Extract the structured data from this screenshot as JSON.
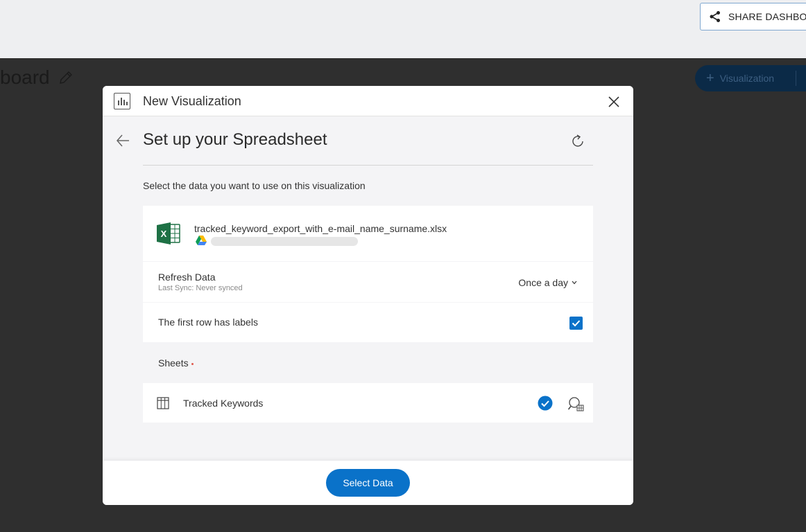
{
  "header": {
    "share_label": "SHARE DASHBOARD"
  },
  "dashboard": {
    "title_fragment": "board",
    "visualization_button_label": "Visualization"
  },
  "modal": {
    "title": "New Visualization",
    "section_title": "Set up your Spreadsheet",
    "instruction": "Select the data you want to use on this visualization",
    "file": {
      "name": "tracked_keyword_export_with_e-mail_name_surname.xlsx",
      "source_icon": "google-drive-icon",
      "type_icon": "excel-icon"
    },
    "refresh": {
      "label": "Refresh Data",
      "last_sync": "Last Sync: Never synced",
      "frequency": "Once a day"
    },
    "first_row_labels": {
      "label": "The first row has labels",
      "checked": true
    },
    "sheets": {
      "label": "Sheets",
      "items": [
        {
          "name": "Tracked Keywords",
          "selected": true
        }
      ]
    },
    "select_button": "Select Data"
  },
  "colors": {
    "accent": "#0a72c9",
    "modal_bg": "#f4f4f6",
    "backdrop": "#2f2f2f",
    "topbar": "#eeeff1"
  }
}
